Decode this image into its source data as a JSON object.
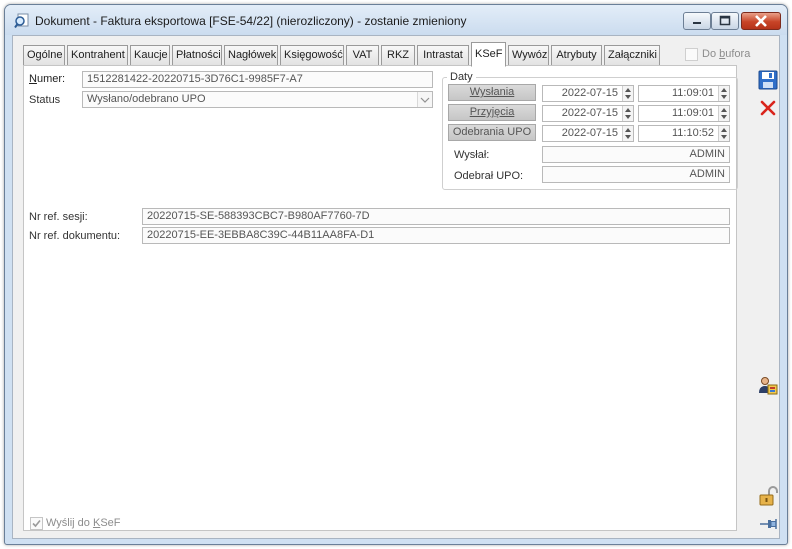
{
  "window": {
    "title": "Dokument - Faktura eksportowa [FSE-54/22] (nierozliczony) - zostanie zmieniony"
  },
  "tabs": [
    {
      "label": "Ogólne"
    },
    {
      "label": "Kontrahent"
    },
    {
      "label": "Kaucje"
    },
    {
      "label": "Płatności"
    },
    {
      "label": "Nagłówek"
    },
    {
      "label": "Księgowość"
    },
    {
      "label": "VAT"
    },
    {
      "label": "RKZ"
    },
    {
      "label": "Intrastat"
    },
    {
      "label": "KSeF"
    },
    {
      "label": "Wywóz"
    },
    {
      "label": "Atrybuty"
    },
    {
      "label": "Załączniki"
    }
  ],
  "active_tab": "KSeF",
  "do_bufora": {
    "label_prefix": "Do ",
    "label_key": "b",
    "label_rest": "ufora",
    "checked": false
  },
  "ksef": {
    "numer": {
      "label_key": "N",
      "label_rest": "umer:",
      "value": "1512281422-20220715-3D76C1-9985F7-A7"
    },
    "status": {
      "label": "Status",
      "value": "Wysłano/odebrano UPO"
    },
    "daty": {
      "title": "Daty",
      "wyslania": {
        "label": "Wysłania",
        "date": "2022-07-15",
        "time": "11:09:01"
      },
      "przyjecia": {
        "label": "Przyjęcia",
        "date": "2022-07-15",
        "time": "11:09:01"
      },
      "odebrania": {
        "label": "Odebrania UPO",
        "date": "2022-07-15",
        "time": "11:10:52"
      },
      "wyslal": {
        "label": "Wysłał:",
        "value": "ADMIN"
      },
      "odebral": {
        "label": "Odebrał UPO:",
        "value": "ADMIN"
      }
    },
    "nr_ref_sesji": {
      "label": "Nr ref. sesji:",
      "value": "20220715-SE-588393CBC7-B980AF7760-7D"
    },
    "nr_ref_dokumentu": {
      "label": "Nr ref. dokumentu:",
      "value": "20220715-EE-3EBBA8C39C-44B11AA8FA-D1"
    },
    "wyslij": {
      "label_prefix": "Wyślij do ",
      "label_key": "K",
      "label_rest": "SeF",
      "checked": true
    }
  },
  "colors": {
    "accent_blue": "#1f5fb5",
    "close_red": "#d9241b",
    "window_frame": "#cfe0f2"
  },
  "icons": [
    "magnifier-doc-icon",
    "save-icon",
    "cancel-x-icon",
    "person-card-icon",
    "padlock-icon",
    "pin-icon"
  ]
}
